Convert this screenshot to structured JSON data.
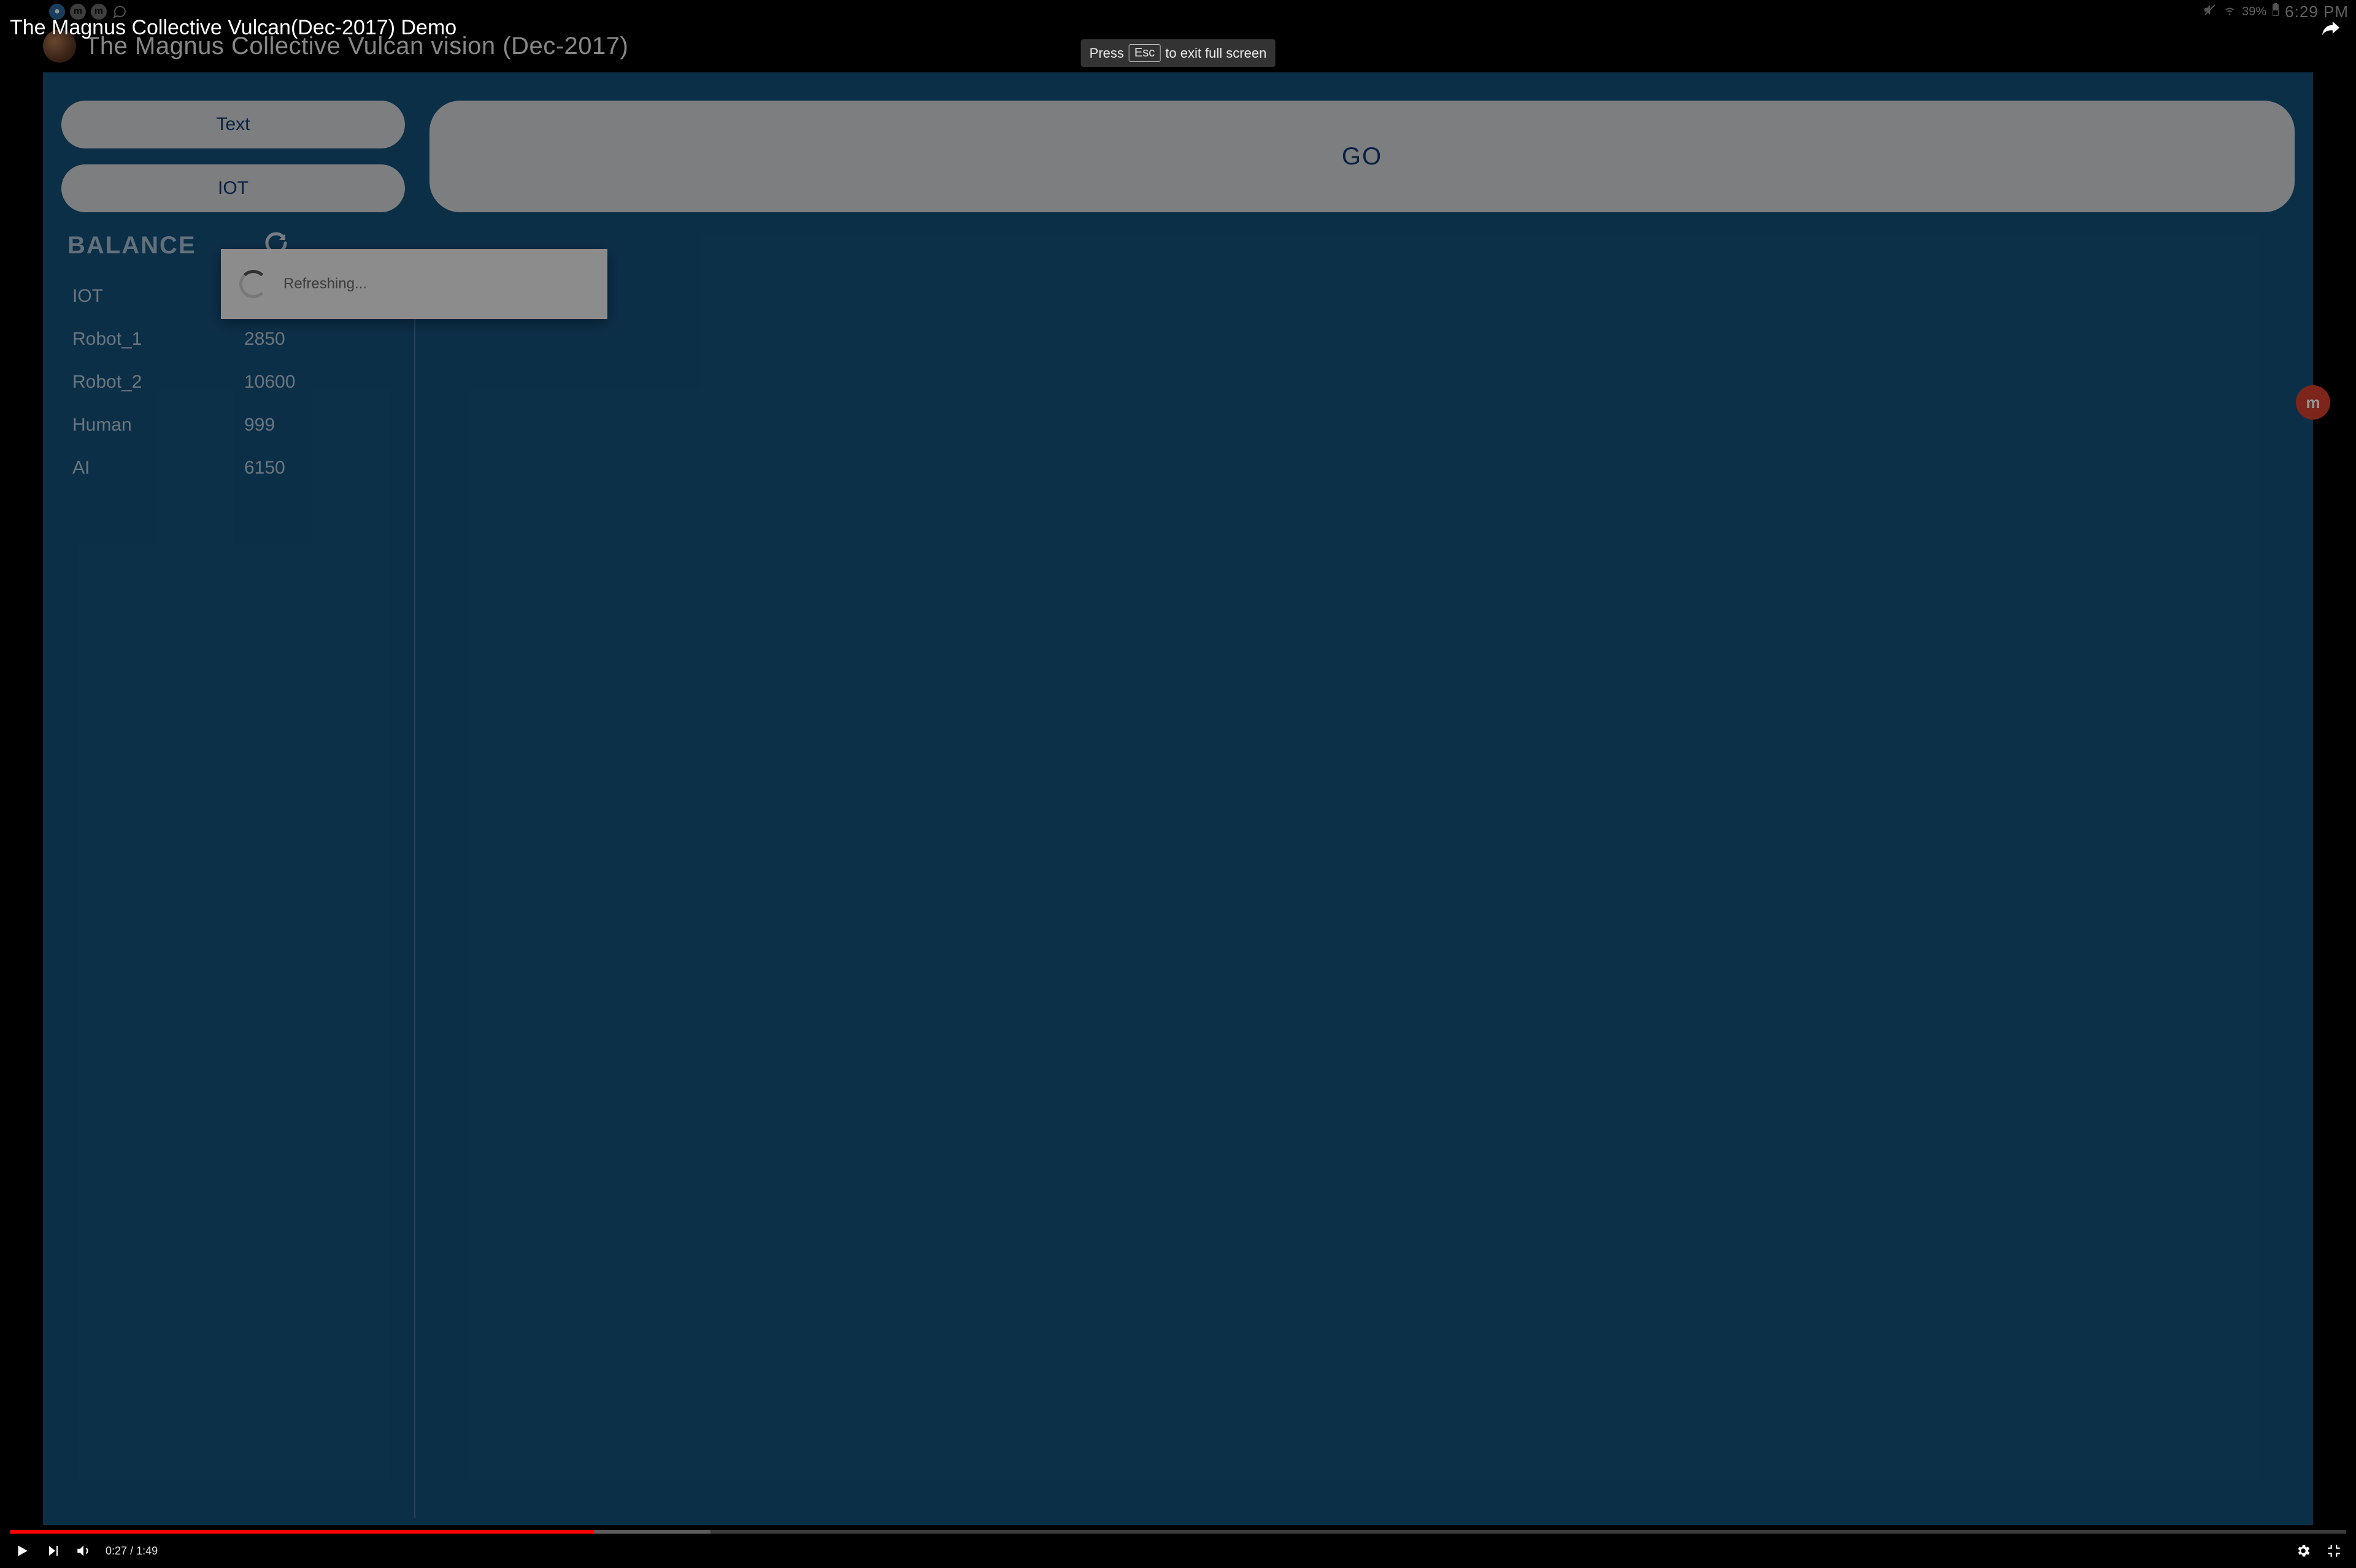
{
  "youtube": {
    "title": "The Magnus Collective Vulcan(Dec-2017) Demo",
    "time_current": "0:27",
    "time_total": "1:49",
    "progress_played_pct": 25,
    "progress_buffered_pct": 30
  },
  "fullscreen_hint": {
    "prefix": "Press",
    "key": "Esc",
    "suffix": "to exit full screen"
  },
  "android_status": {
    "battery_pct": "39%",
    "time": "6:29 PM"
  },
  "app": {
    "title": "The Magnus Collective Vulcan vision (Dec-2017)",
    "buttons": {
      "text": "Text",
      "iot": "IOT",
      "go": "GO"
    },
    "balance_label": "BALANCE",
    "balance_rows": [
      {
        "name": "IOT",
        "value": ""
      },
      {
        "name": "Robot_1",
        "value": "2850"
      },
      {
        "name": "Robot_2",
        "value": "10600"
      },
      {
        "name": "Human",
        "value": "999"
      },
      {
        "name": "AI",
        "value": "6150"
      }
    ],
    "modal_text": "Refreshing...",
    "floating_badge": "m"
  }
}
